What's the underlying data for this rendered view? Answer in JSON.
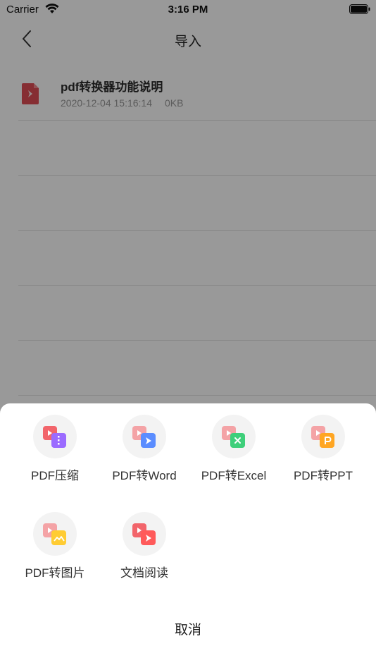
{
  "status_bar": {
    "carrier": "Carrier",
    "time": "3:16 PM"
  },
  "nav": {
    "title": "导入"
  },
  "files": [
    {
      "name": "pdf转换器功能说明",
      "date": "2020-12-04 15:16:14",
      "size": "0KB"
    }
  ],
  "sheet": {
    "tools": [
      {
        "label": "PDF压缩",
        "icon": "pdf-compress-icon",
        "accent": "#9b6bff"
      },
      {
        "label": "PDF转Word",
        "icon": "pdf-to-word-icon",
        "accent": "#5b8dff"
      },
      {
        "label": "PDF转Excel",
        "icon": "pdf-to-excel-icon",
        "accent": "#3ecf7a"
      },
      {
        "label": "PDF转PPT",
        "icon": "pdf-to-ppt-icon",
        "accent": "#ffa623"
      },
      {
        "label": "PDF转图片",
        "icon": "pdf-to-image-icon",
        "accent": "#ffcc33"
      },
      {
        "label": "文档阅读",
        "icon": "document-read-icon",
        "accent": "#ff5a5a"
      }
    ],
    "cancel_label": "取消"
  },
  "colors": {
    "pdf_red": "#f2656b",
    "overlay": "rgba(0,0,0,0.4)"
  }
}
